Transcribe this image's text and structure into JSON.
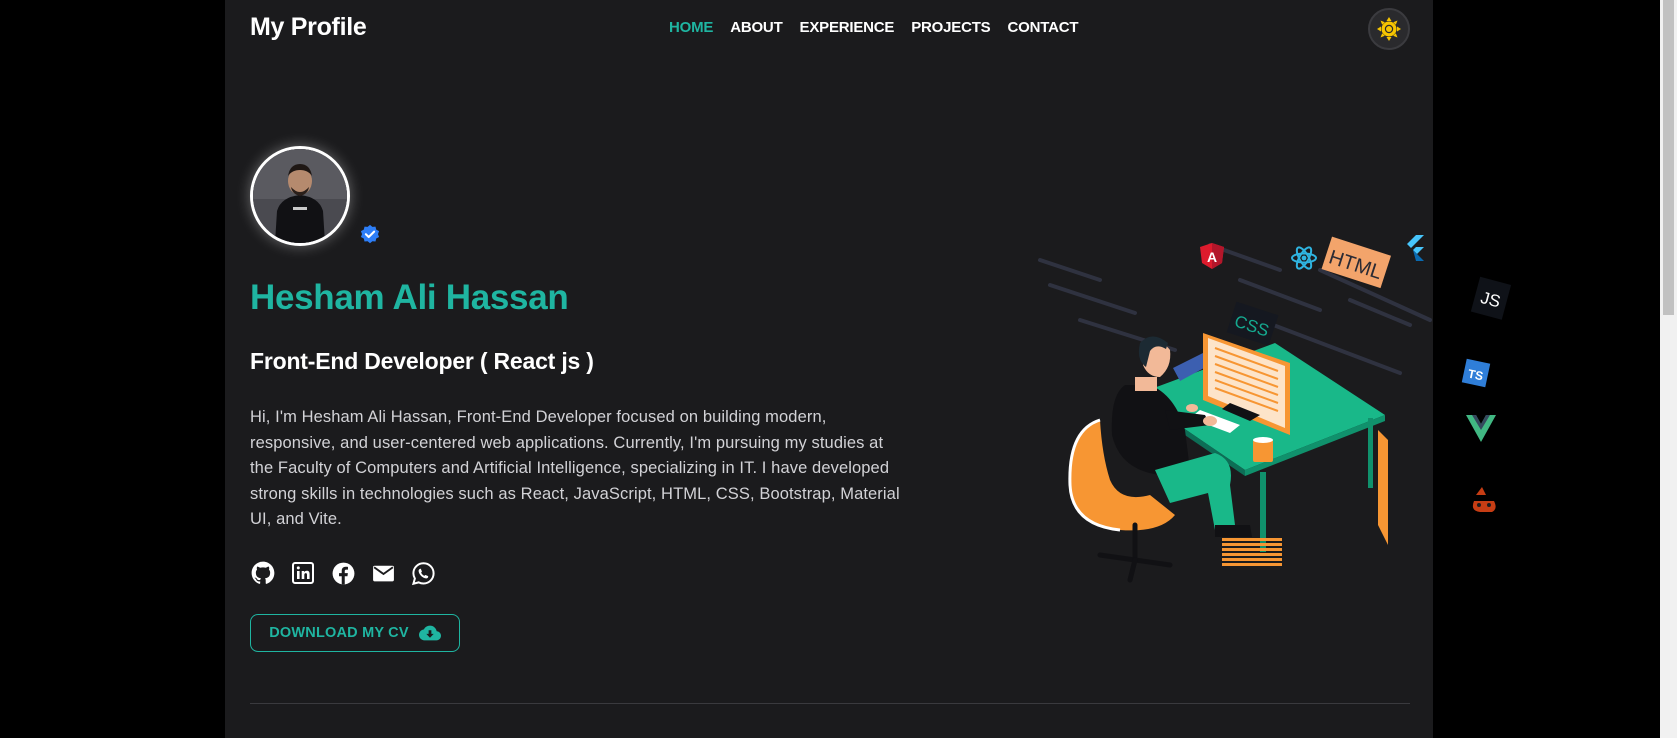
{
  "header": {
    "brand": "My Profile",
    "nav": [
      {
        "label": "HOME",
        "active": true
      },
      {
        "label": "ABOUT",
        "active": false
      },
      {
        "label": "EXPERIENCE",
        "active": false
      },
      {
        "label": "PROJECTS",
        "active": false
      },
      {
        "label": "CONTACT",
        "active": false
      }
    ],
    "theme_icon": "sun-icon"
  },
  "hero": {
    "name": "Hesham Ali Hassan",
    "role": "Front-End Developer ( React js )",
    "bio": "Hi, I'm Hesham Ali Hassan, Front-End Developer focused on building modern, responsive, and user-centered web applications. Currently, I'm pursuing my studies at the Faculty of Computers and Artificial Intelligence, specializing in IT. I have developed strong skills in technologies such as React, JavaScript, HTML, CSS, Bootstrap, Material UI, and Vite.",
    "socials": [
      "github-icon",
      "linkedin-icon",
      "facebook-icon",
      "email-icon",
      "whatsapp-icon"
    ],
    "cv_button": "DOWNLOAD MY CV",
    "illustration_labels": {
      "html": "HTML",
      "css": "CSS",
      "js": "JS",
      "ts": "TS"
    }
  },
  "colors": {
    "accent": "#1fb5a1",
    "background": "#1b1b1d",
    "text": "#ffffff",
    "body_text": "#d2d2d6",
    "sun": "#f7c600",
    "verified": "#2d7ef7"
  }
}
